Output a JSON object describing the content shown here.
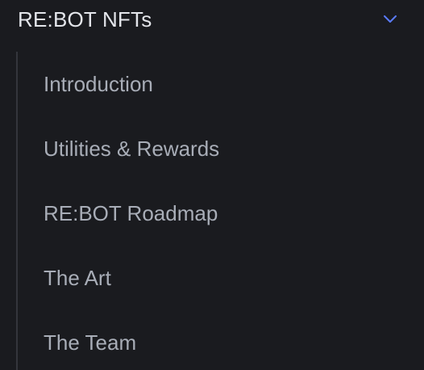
{
  "group": {
    "title": "RE:BOT NFTs",
    "expanded": true,
    "chevron_icon": "chevron-down-icon",
    "accent_color": "#5b7cff"
  },
  "items": [
    {
      "label": "Introduction"
    },
    {
      "label": "Utilities & Rewards"
    },
    {
      "label": "RE:BOT Roadmap"
    },
    {
      "label": "The Art"
    },
    {
      "label": "The Team"
    }
  ]
}
